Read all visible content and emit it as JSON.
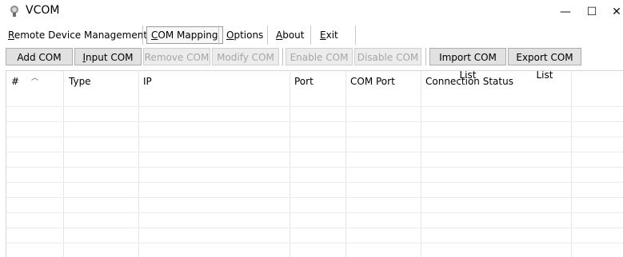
{
  "window": {
    "title": "VCOM",
    "minimize": "—",
    "maximize": "☐",
    "close": "✕"
  },
  "menu": {
    "remote": "Remote Device Management",
    "com_mapping": "COM Mapping",
    "options": "Options",
    "about": "About",
    "exit": "Exit"
  },
  "toolbar": {
    "add_com": "Add COM",
    "input_com": "Input COM",
    "remove_com": "Remove COM",
    "modify_com": "Modify COM",
    "enable_com": "Enable COM",
    "disable_com": "Disable COM",
    "import_list": "Import COM List",
    "export_list": "Export COM List"
  },
  "table": {
    "columns": [
      "#",
      "Type",
      "IP",
      "Port",
      "COM Port",
      "Connection Status"
    ],
    "rows": []
  }
}
